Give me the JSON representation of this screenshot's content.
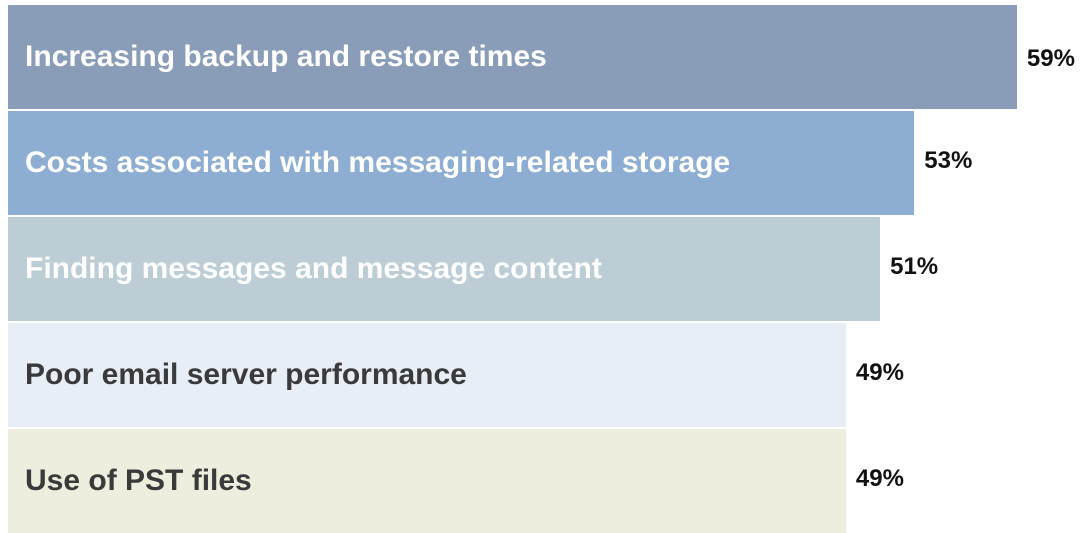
{
  "chart_data": {
    "type": "bar",
    "orientation": "horizontal",
    "categories": [
      "Increasing backup and restore times",
      "Costs associated with messaging-related storage",
      "Finding messages and message content",
      "Poor email server performance",
      "Use of PST files"
    ],
    "values": [
      59,
      53,
      51,
      49,
      49
    ],
    "value_labels": [
      "59%",
      "53%",
      "51%",
      "49%",
      "49%"
    ],
    "unit": "%",
    "colors": [
      "#8a9db8",
      "#8daed2",
      "#bccdd6",
      "#e7eef5",
      "#eeeedf"
    ],
    "label_colors": [
      "#ffffff",
      "#ffffff",
      "#ffffff",
      "#3a3a3a",
      "#3a3a3a"
    ],
    "grid": false,
    "legend": "none"
  }
}
